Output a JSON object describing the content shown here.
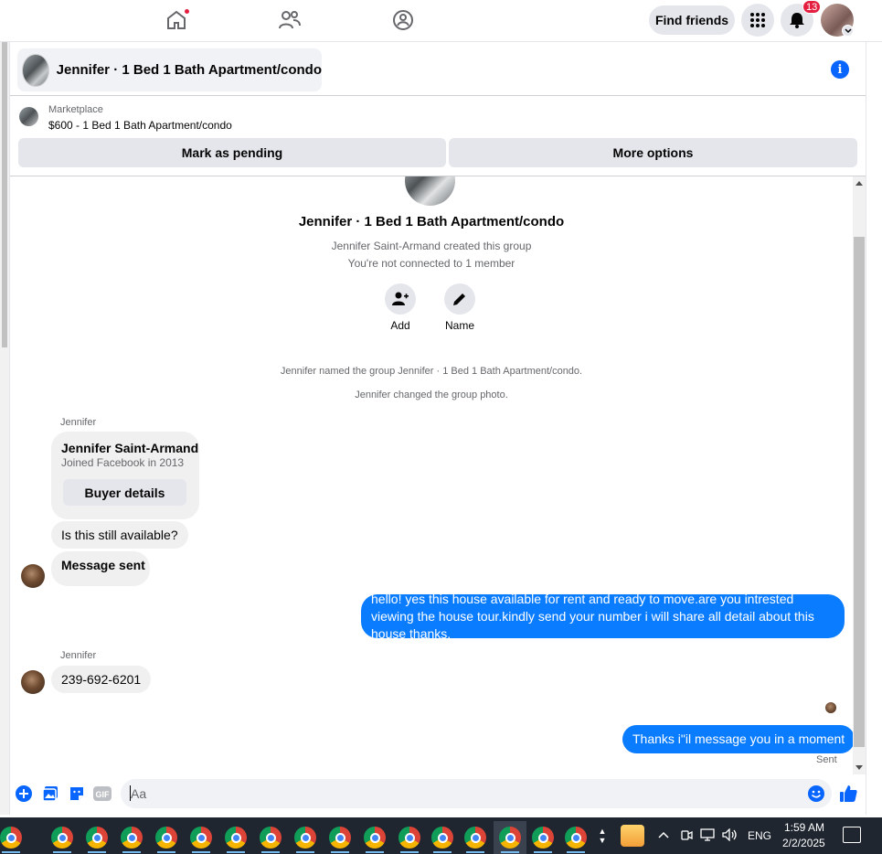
{
  "nav": {
    "find_friends": "Find friends",
    "notification_count": "13"
  },
  "chat": {
    "title": "Jennifer · 1 Bed 1 Bath Apartment/condo",
    "marketplace_label": "Marketplace",
    "listing": "$600 - 1 Bed 1 Bath Apartment/condo",
    "mark_pending": "Mark as pending",
    "more_options": "More options"
  },
  "intro": {
    "group_name": "Jennifer · 1 Bed 1 Bath Apartment/condo",
    "created_by": "Jennifer Saint-Armand created this group",
    "not_connected": "You're not connected to 1 member",
    "add_label": "Add",
    "name_label": "Name",
    "sys_named": "Jennifer named the group Jennifer · 1 Bed 1 Bath Apartment/condo.",
    "sys_photo": "Jennifer changed the group photo."
  },
  "messages": {
    "sender1": "Jennifer",
    "buyer_name": "Jennifer Saint-Armand",
    "buyer_joined": "Joined Facebook in 2013",
    "buyer_details": "Buyer details",
    "msg_available": "Is this still available?",
    "msg_sent_bold": "Message sent",
    "reply1": "hello! yes this house available for rent and ready to move.are you intrested viewing the house tour.kindly send your number i will share all detail about this house thanks.",
    "sender2": "Jennifer",
    "phone": "239-692-6201",
    "reply2": "Thanks i\"il message you in a moment",
    "sent_status": "Sent"
  },
  "composer": {
    "placeholder": "Aa"
  },
  "taskbar": {
    "language": "ENG",
    "time": "1:59 AM",
    "date": "2/2/2025"
  },
  "colors": {
    "accent": "#0866ff",
    "outgoing_bubble": "#0a7cff",
    "badge": "#e41e3f"
  }
}
